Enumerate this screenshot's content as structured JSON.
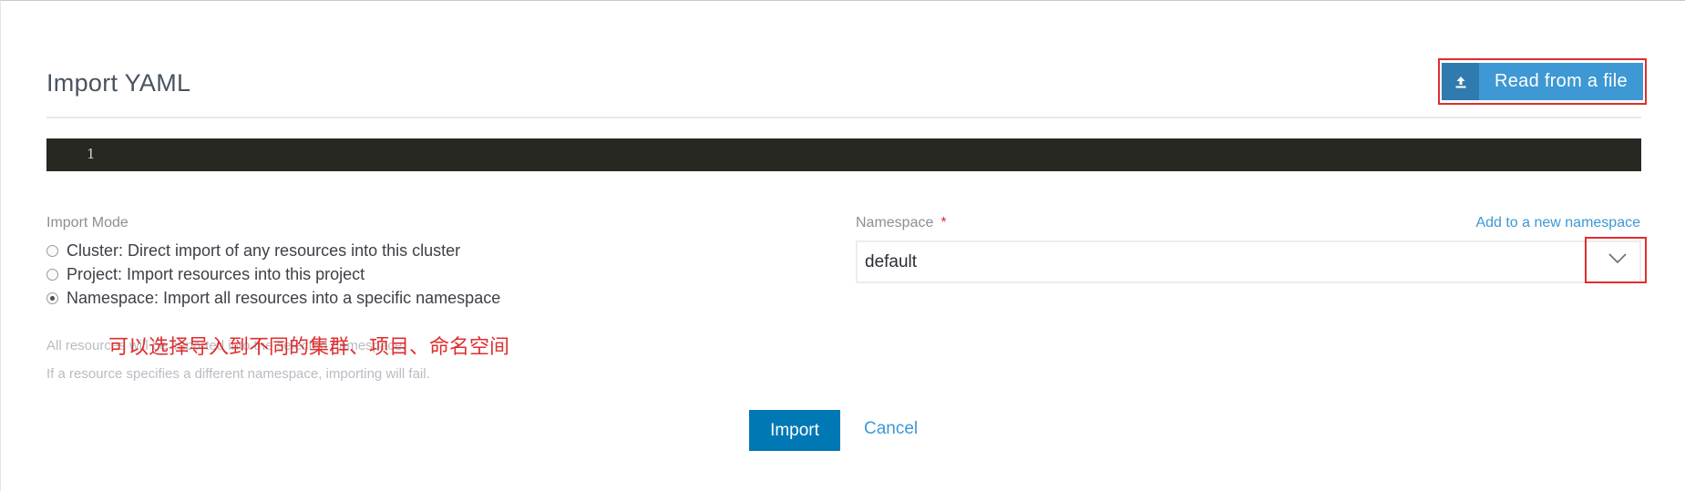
{
  "header": {
    "title": "Import YAML",
    "read_button_label": "Read from a file",
    "read_button_icon": "upload-icon"
  },
  "editor": {
    "line_number": "1",
    "content": ""
  },
  "import_mode": {
    "label": "Import Mode",
    "options": [
      {
        "label": "Cluster: Direct import of any resources into this cluster",
        "checked": false
      },
      {
        "label": "Project: Import resources into this project",
        "checked": false
      },
      {
        "label": "Namespace: Import all resources into a specific namespace",
        "checked": true
      }
    ],
    "help_line_1": "All resources will be imported into the selected namespace.",
    "help_line_2": "If a resource specifies a different namespace, importing will fail."
  },
  "annotation": "可以选择导入到不同的集群、项目、命名空间",
  "namespace": {
    "label": "Namespace",
    "required_mark": "*",
    "add_link": "Add to a new namespace",
    "selected": "default",
    "dropdown_icon": "chevron-down-icon"
  },
  "actions": {
    "import_label": "Import",
    "cancel_label": "Cancel"
  },
  "colors": {
    "primary": "#0078b4",
    "accent": "#3d98d3",
    "annotation_red": "#e12d2d",
    "editor_bg": "#272822"
  }
}
